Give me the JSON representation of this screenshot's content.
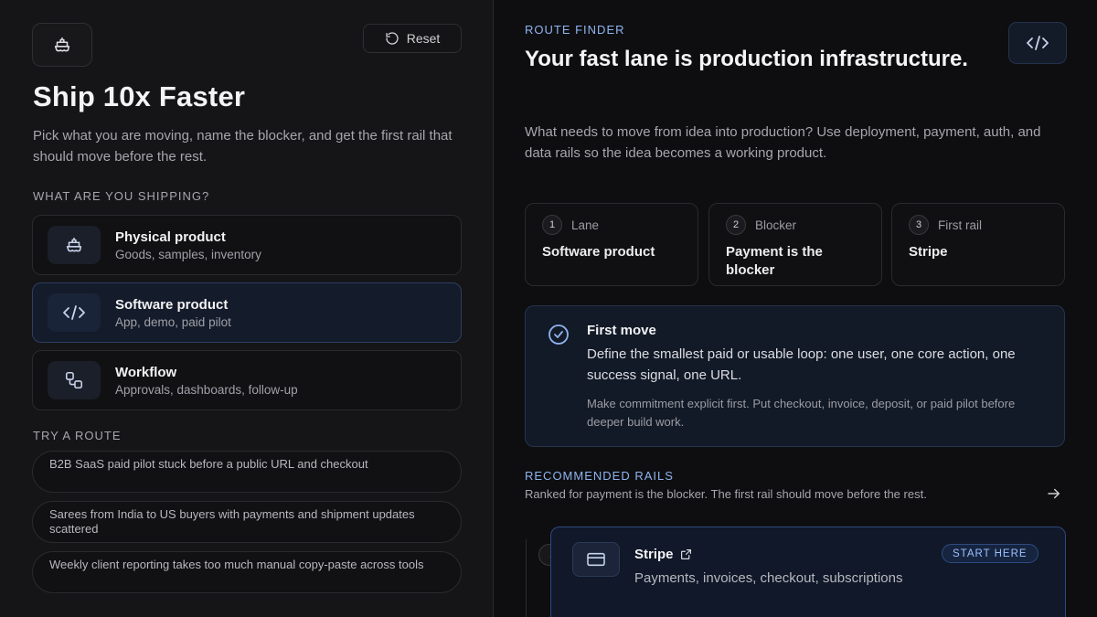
{
  "left": {
    "reset_label": "Reset",
    "title": "Ship 10x Faster",
    "subtitle": "Pick what you are moving, name the blocker, and get the first rail that should move before the rest.",
    "shipping_label": "WHAT ARE YOU SHIPPING?",
    "options": [
      {
        "title": "Physical product",
        "sub": "Goods, samples, inventory",
        "icon": "ship-icon",
        "active": false
      },
      {
        "title": "Software product",
        "sub": "App, demo, paid pilot",
        "icon": "code-icon",
        "active": true
      },
      {
        "title": "Workflow",
        "sub": "Approvals, dashboards, follow-up",
        "icon": "workflow-icon",
        "active": false
      }
    ],
    "try_label": "TRY A ROUTE",
    "routes": [
      "B2B SaaS paid pilot stuck before a public URL and checkout",
      "Sarees from India to US buyers with payments and shipment updates scattered",
      "Weekly client reporting takes too much manual copy-paste across tools"
    ]
  },
  "right": {
    "finder_label": "ROUTE FINDER",
    "headline": "Your fast lane is production infrastructure.",
    "description": "What needs to move from idea into production? Use deployment, payment, auth, and data rails so the idea becomes a working product.",
    "lanes": [
      {
        "num": "1",
        "label": "Lane",
        "value": "Software product"
      },
      {
        "num": "2",
        "label": "Blocker",
        "value": "Payment is the blocker"
      },
      {
        "num": "3",
        "label": "First rail",
        "value": "Stripe"
      }
    ],
    "first_move": {
      "title": "First move",
      "text": "Define the smallest paid or usable loop: one user, one core action, one success signal, one URL.",
      "note": "Make commitment explicit first. Put checkout, invoice, deposit, or paid pilot before deeper build work."
    },
    "rails_label": "RECOMMENDED RAILS",
    "rails_sub": "Ranked for payment is the blocker. The first rail should move before the rest.",
    "rails": [
      {
        "num": "1",
        "title": "Stripe",
        "desc": "Payments, invoices, checkout, subscriptions",
        "badge": "START HERE"
      }
    ]
  },
  "colors": {
    "accent": "#8fb4f0",
    "active_bg": "#141b2a",
    "badge_text": "#9cc0ff"
  }
}
